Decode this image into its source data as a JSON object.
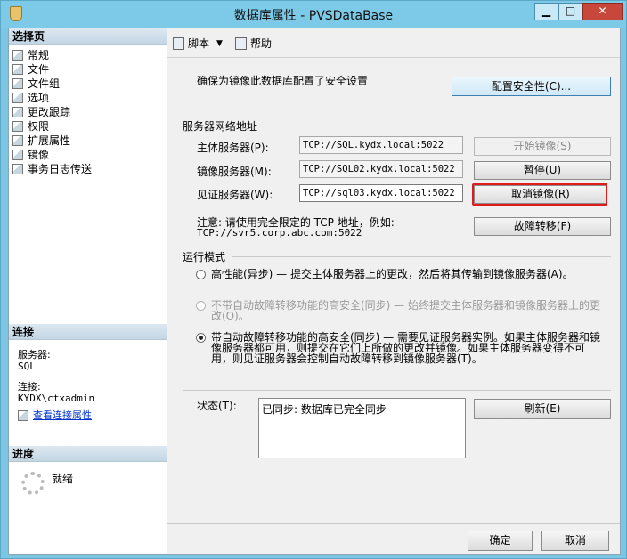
{
  "window": {
    "title": "数据库属性 - PVSDataBase",
    "minimize": "▁",
    "maximize": "□",
    "close": "✕"
  },
  "left": {
    "select_page_header": "选择页",
    "pages": [
      {
        "label": "常规"
      },
      {
        "label": "文件"
      },
      {
        "label": "文件组"
      },
      {
        "label": "选项"
      },
      {
        "label": "更改跟踪"
      },
      {
        "label": "权限"
      },
      {
        "label": "扩展属性"
      },
      {
        "label": "镜像"
      },
      {
        "label": "事务日志传送"
      }
    ],
    "connection_header": "连接",
    "server_label": "服务器:",
    "server_value": "SQL",
    "conn_label": "连接:",
    "conn_value": "KYDX\\ctxadmin",
    "view_props_link": "查看连接属性",
    "progress_header": "进度",
    "progress_status": "就绪"
  },
  "toolbar": {
    "script": "脚本",
    "help": "帮助"
  },
  "mirror": {
    "security_desc": "确保为镜像此数据库配置了安全设置",
    "configure_security": "配置安全性(C)...",
    "network_group": "服务器网络地址",
    "principal_label": "主体服务器(P):",
    "principal_value": "TCP://SQL.kydx.local:5022",
    "mirror_label": "镜像服务器(M):",
    "mirror_value": "TCP://SQL02.kydx.local:5022",
    "witness_label": "见证服务器(W):",
    "witness_value": "TCP://sql03.kydx.local:5022",
    "start_mirror": "开始镜像(S)",
    "pause": "暂停(U)",
    "remove_mirror": "取消镜像(R)",
    "failover": "故障转移(F)",
    "note_line1": "注意: 请使用完全限定的 TCP 地址，例如:",
    "note_line2": "TCP://svr5.corp.abc.com:5022",
    "mode_group": "运行模式",
    "mode_high_perf": "高性能(异步) — 提交主体服务器上的更改，然后将其传输到镜像服务器(A)。",
    "mode_high_safety_no_failover": "不带自动故障转移功能的高安全(同步) — 始终提交主体服务器和镜像服务器上的更改(O)。",
    "mode_high_safety_failover": "带自动故障转移功能的高安全(同步) — 需要见证服务器实例。如果主体服务器和镜像服务器都可用，则提交在它们上所做的更改并镜像。如果主体服务器变得不可用，则见证服务器会控制自动故障转移到镜像服务器(T)。",
    "status_label": "状态(T):",
    "status_value": "已同步: 数据库已完全同步",
    "refresh": "刷新(E)"
  },
  "footer": {
    "ok": "确定",
    "cancel": "取消"
  },
  "colors": {
    "highlight": "#e01b1b",
    "titlebar": "#7ccae8",
    "close": "#c7483a"
  }
}
